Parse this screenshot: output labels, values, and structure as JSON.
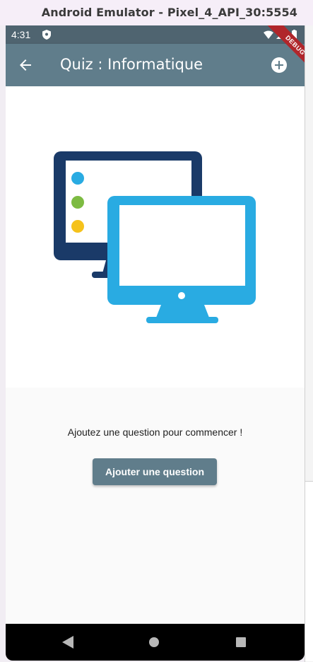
{
  "window": {
    "title": "Android Emulator - Pixel_4_API_30:5554"
  },
  "status_bar": {
    "time": "4:31"
  },
  "app_bar": {
    "title": "Quiz : Informatique",
    "back_icon": "arrow-back-icon",
    "add_icon": "add-circle-icon"
  },
  "debug_banner": {
    "label": "DEBUG"
  },
  "hero": {
    "illustration": "computer-monitors-illustration",
    "colors": {
      "dark_monitor": "#1a3a68",
      "light_monitor": "#29abe2",
      "dot_blue": "#29abe2",
      "dot_green": "#7dbb42",
      "dot_yellow": "#f5c21b"
    }
  },
  "main": {
    "empty_message": "Ajoutez une question pour commencer !",
    "add_question_label": "Ajouter une question"
  },
  "nav_bar": {
    "back_icon": "nav-back-icon",
    "home_icon": "nav-home-icon",
    "recents_icon": "nav-recents-icon"
  },
  "theme": {
    "app_bar_color": "#607d8b",
    "status_bar_color": "#4f6470",
    "debug_color": "#b0262b"
  }
}
